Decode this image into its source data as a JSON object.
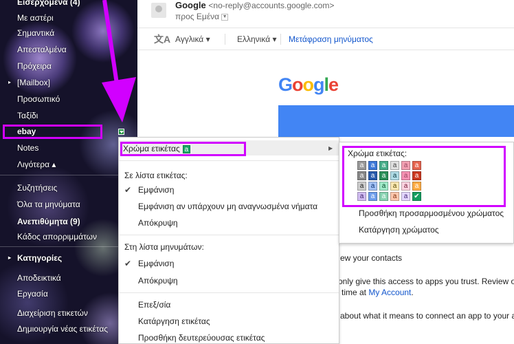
{
  "sidebar": {
    "items": [
      {
        "label": "Εισερχόμενα (4)",
        "bold": true
      },
      {
        "label": "Με αστέρι",
        "bold": false
      },
      {
        "label": "Σημαντικά",
        "bold": false
      },
      {
        "label": "Απεσταλμένα",
        "bold": false
      },
      {
        "label": "Πρόχειρα",
        "bold": false
      },
      {
        "label": "[Mailbox]",
        "bold": false
      },
      {
        "label": "Προσωπικό",
        "bold": false
      },
      {
        "label": "Ταξίδι",
        "bold": false
      },
      {
        "label": "ebay",
        "bold": true
      },
      {
        "label": "Notes",
        "bold": false
      },
      {
        "label": "Λιγότερα",
        "bold": false
      },
      {
        "label": "Συζητήσεις",
        "bold": false
      },
      {
        "label": "Όλα τα μηνύματα",
        "bold": false
      },
      {
        "label": "Ανεπιθύμητα (9)",
        "bold": true
      },
      {
        "label": "Κάδος απορριμμάτων",
        "bold": false
      },
      {
        "label": "Κατηγορίες",
        "bold": true
      },
      {
        "label": "Αποδεικτικά",
        "bold": false
      },
      {
        "label": "Εργασία",
        "bold": false
      },
      {
        "label": "Διαχείριση ετικετών",
        "bold": false
      },
      {
        "label": "Δημιουργία νέας ετικέτας",
        "bold": false
      }
    ],
    "less_caret": "▴"
  },
  "email": {
    "sender_name": "Google",
    "sender_email": "<no-reply@accounts.google.com>",
    "to": "προς Εμένα",
    "translate": {
      "from_lang": "Αγγλικά",
      "to_lang": "Ελληνικά",
      "translate_link": "Μετάφραση μηνύματος"
    },
    "logo_letters": [
      "G",
      "o",
      "o",
      "g",
      "l",
      "e"
    ],
    "body_lines": {
      "l1": "ew your contacts",
      "l2": "only give this access to apps you trust. Review or",
      "l3_pre": "time at ",
      "l3_link": "My Account",
      "l3_post": ".",
      "l4": "about what it means to connect an app to your ac"
    }
  },
  "menu": {
    "color_label": "Χρώμα ετικέτας",
    "color_swatch_letter": "a",
    "in_label_list_header": "Σε λίστα ετικέτας:",
    "label_list": [
      "Εμφάνιση",
      "Εμφάνιση αν υπάρχουν μη αναγνωσμένα νήματα",
      "Απόκρυψη"
    ],
    "in_message_list_header": "Στη λίστα μηνυμάτων:",
    "message_list": [
      "Εμφάνιση",
      "Απόκρυψη"
    ],
    "actions": [
      "Επεξ/σία",
      "Κατάργηση ετικέτας",
      "Προσθήκη δευτερεύουσας ετικέτας"
    ]
  },
  "submenu": {
    "title": "Χρώμα ετικέτας:",
    "swatch_letter": "a",
    "add_custom": "Προσθήκη προσαρμοσμένου χρώματος",
    "remove_color": "Κατάργηση χρώματος"
  },
  "colors": {
    "highlight": "#d100ff",
    "google_blue": "#4285f4",
    "link": "#1155cc",
    "logo": [
      "#4285f4",
      "#ea4335",
      "#fbbc05",
      "#4285f4",
      "#34a853",
      "#ea4335"
    ],
    "palette_bg": [
      [
        "#999999",
        "#3d78d8",
        "#47ad89",
        "#e1e1e1",
        "#f2a0b2",
        "#e66550"
      ],
      [
        "#888888",
        "#285bac",
        "#2b8f58",
        "#b0dbe6",
        "#f691b3",
        "#cc3a21"
      ],
      [
        "#cccccc",
        "#a4c2f4",
        "#a0eac9",
        "#fce8b3",
        "#fbd3e0",
        "#ffad46"
      ],
      [
        "#d0bcf1",
        "#6d9eeb",
        "#89d3b2",
        "#ffc8af",
        "#e3d7ff",
        "#149e60"
      ]
    ],
    "palette_fg": [
      [
        "#ffffff",
        "#ffffff",
        "#ffffff",
        "#444444",
        "#994a64",
        "#ffffff"
      ],
      [
        "#ffffff",
        "#ffffff",
        "#ffffff",
        "#0d3b44",
        "#994a64",
        "#ffffff"
      ],
      [
        "#222222",
        "#0d3472",
        "#0b4f30",
        "#594c05",
        "#711a36",
        "#ffffff"
      ],
      [
        "#41236d",
        "#ffffff",
        "#ffffff",
        "#7a2e0b",
        "#41236d",
        "#ffffff"
      ]
    ],
    "selected_swatch": "#16a765"
  }
}
